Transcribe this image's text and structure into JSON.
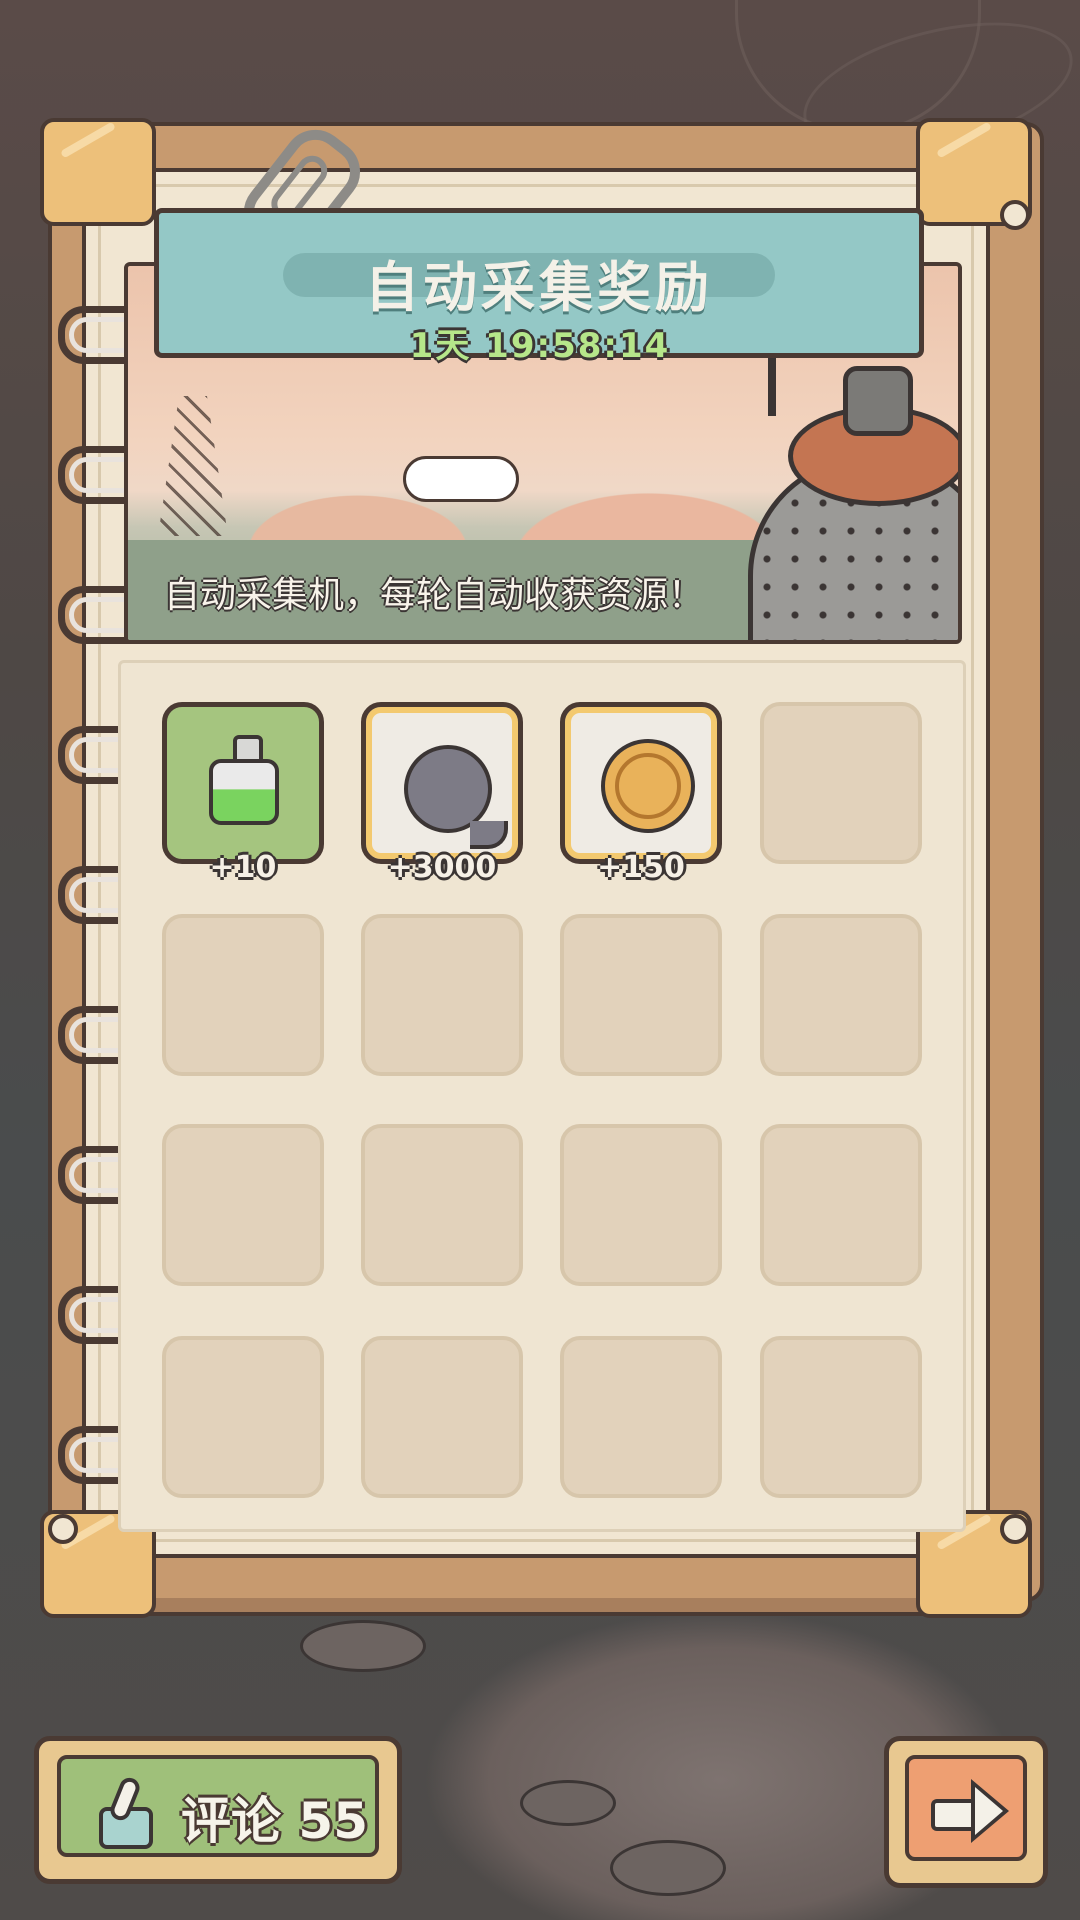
{
  "panel": {
    "title": "自动采集奖励",
    "timer": "1天 19:58:14",
    "description": "自动采集机，每轮自动收获资源！"
  },
  "rewards": [
    {
      "icon": "potion-flask-icon",
      "amount": "+10",
      "style": "green"
    },
    {
      "icon": "gray-blob-icon",
      "amount": "+3000",
      "style": "gold"
    },
    {
      "icon": "gold-coin-icon",
      "amount": "+150",
      "style": "gold"
    }
  ],
  "bottom": {
    "comment_label": "评论 55",
    "next_icon": "right-arrow-icon"
  },
  "colors": {
    "title_plate": "#94c8c6",
    "timer_text": "#b6e68a",
    "comment_button": "#9fc07a",
    "next_button": "#ee9f72",
    "slot_empty": "#e2d2bb"
  }
}
